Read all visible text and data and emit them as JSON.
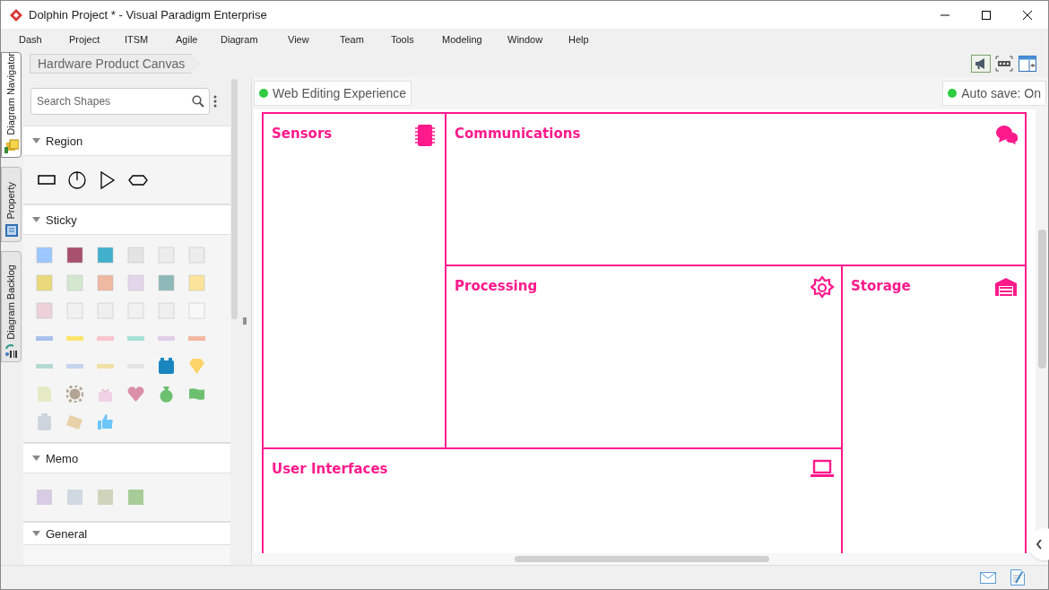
{
  "window": {
    "title": "Dolphin Project * - Visual Paradigm Enterprise"
  },
  "menu": [
    "Dash",
    "Project",
    "ITSM",
    "Agile",
    "Diagram",
    "View",
    "Team",
    "Tools",
    "Modeling",
    "Window",
    "Help"
  ],
  "side_tabs": [
    {
      "label": "Diagram Navigator",
      "selected": true
    },
    {
      "label": "Property",
      "selected": false
    },
    {
      "label": "Diagram Backlog",
      "selected": false
    }
  ],
  "breadcrumb": "Hardware Product Canvas",
  "search": {
    "placeholder": "Search Shapes"
  },
  "palette": [
    {
      "title": "Region",
      "expanded": true
    },
    {
      "title": "Sticky",
      "expanded": true
    },
    {
      "title": "Memo",
      "expanded": true
    },
    {
      "title": "General",
      "expanded": true
    }
  ],
  "badges": [
    {
      "label": "Web Editing Experience",
      "color": "#2ecc40"
    },
    {
      "label": "Auto save: On",
      "color": "#2ecc40"
    }
  ],
  "regions": [
    {
      "title": "Sensors",
      "kind": "chip"
    },
    {
      "title": "Communications",
      "kind": "chat"
    },
    {
      "title": "Processing",
      "kind": "gear"
    },
    {
      "title": "Storage",
      "kind": "garage"
    },
    {
      "title": "User Interfaces",
      "kind": "laptop"
    }
  ]
}
